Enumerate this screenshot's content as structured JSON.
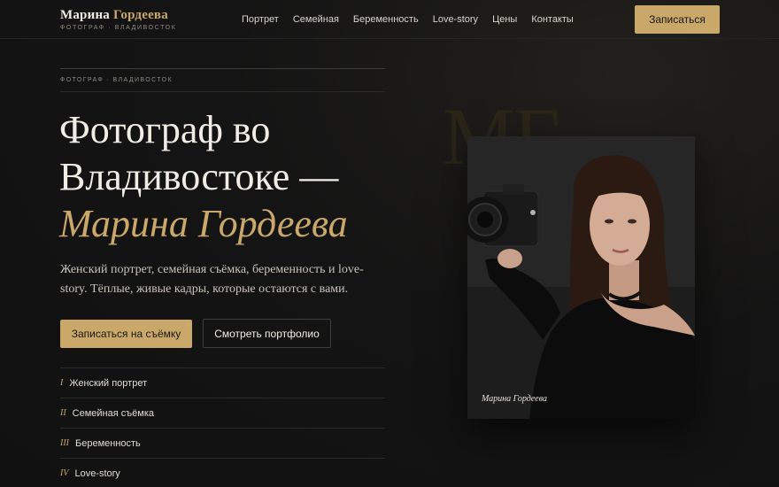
{
  "header": {
    "brand_first": "Марина",
    "brand_last": "Гордеева",
    "brand_subtitle": "ФОТОГРАФ · ВЛАДИВОСТОК",
    "nav": [
      "Портрет",
      "Семейная",
      "Беременность",
      "Love-story",
      "Цены",
      "Контакты"
    ],
    "cta_label": "Записаться"
  },
  "hero": {
    "eyebrow": "ФОТОГРАФ · ВЛАДИВОСТОК",
    "headline_line1": "Фотограф во",
    "headline_line2": "Владивостоке —",
    "headline_name": "Марина Гордеева",
    "lead": "Женский портрет, семейная съёмка, беременность и love-story. Тёплые, живые кадры, которые остаются с вами.",
    "primary_button": "Записаться на съёмку",
    "secondary_button": "Смотреть портфолио",
    "services": [
      {
        "num": "I",
        "label": "Женский портрет"
      },
      {
        "num": "II",
        "label": "Семейная съёмка"
      },
      {
        "num": "III",
        "label": "Беременность"
      },
      {
        "num": "IV",
        "label": "Love-story"
      }
    ]
  },
  "visual": {
    "monogram": "МГ",
    "photo_caption": "Марина Гордеева"
  },
  "colors": {
    "accent": "#c9a86a",
    "background": "#141414",
    "text": "#f2ede4"
  }
}
